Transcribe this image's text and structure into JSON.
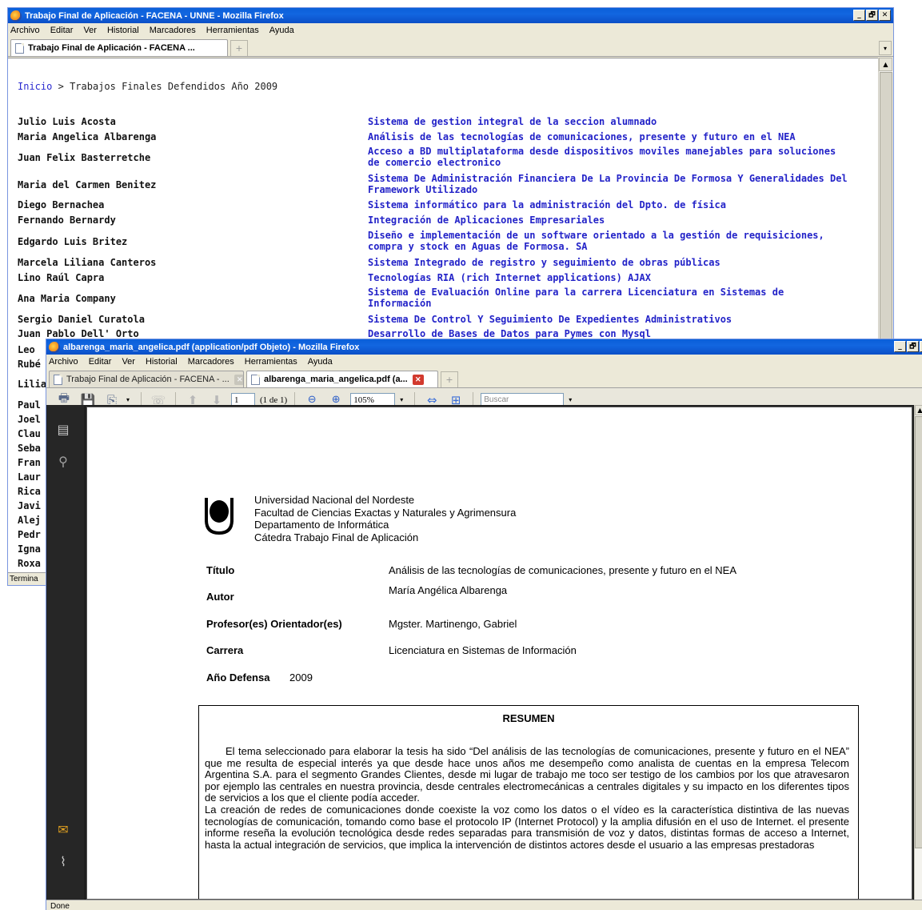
{
  "window1": {
    "title": "Trabajo Final de Aplicación - FACENA - UNNE - Mozilla Firefox",
    "window_controls": [
      "_",
      "🗗",
      "✕"
    ],
    "menu": [
      "Archivo",
      "Editar",
      "Ver",
      "Historial",
      "Marcadores",
      "Herramientas",
      "Ayuda"
    ],
    "tab_label": "Trabajo Final de Aplicación - FACENA ...",
    "breadcrumb": {
      "home": "Inicio",
      "separator": ">",
      "current": "Trabajos Finales Defendidos Año 2009"
    },
    "rows": [
      {
        "author": "Julio Luis Acosta",
        "title": "Sistema de gestion integral de la seccion alumnado"
      },
      {
        "author": "Maria Angelica Albarenga",
        "title": "Análisis de las tecnologías de comunicaciones, presente y futuro en el NEA"
      },
      {
        "author": "Juan Felix Basterretche",
        "title": "Acceso a BD multiplataforma desde dispositivos moviles manejables para soluciones de comercio electronico"
      },
      {
        "author": "Maria del Carmen Benitez",
        "title": "Sistema De Administración Financiera De La Provincia De Formosa Y Generalidades Del Framework Utilizado"
      },
      {
        "author": "Diego Bernachea",
        "title": "Sistema informático para la administración del Dpto. de física"
      },
      {
        "author": "Fernando Bernardy",
        "title": "Integración de Aplicaciones Empresariales"
      },
      {
        "author": "Edgardo Luis Britez",
        "title": "Diseño e implementación de un software orientado a la gestión de requisiciones, compra y stock en Aguas de Formosa. SA"
      },
      {
        "author": "Marcela Liliana Canteros",
        "title": "Sistema Integrado de registro y seguimiento de obras públicas"
      },
      {
        "author": "Lino Raúl Capra",
        "title": "Tecnologías RIA (rich Internet applications) AJAX"
      },
      {
        "author": "Ana Maria Company",
        "title": "Sistema de Evaluación Online para la carrera Licenciatura en Sistemas de Información"
      },
      {
        "author": "Sergio Daniel Curatola",
        "title": "Sistema De Control Y Seguimiento De Expedientes Administrativos"
      },
      {
        "author": "Juan Pablo Dell' Orto",
        "title": "Desarrollo de Bases de Datos para Pymes con Mysql"
      }
    ],
    "partial_authors": [
      "Leo",
      "Rubé",
      "Lilian",
      "Paul",
      "Joel",
      "Clau",
      "Seba",
      "Fran",
      "Laur",
      "Rica",
      "Javi",
      "Alej",
      "Pedr",
      "Igna",
      "Roxa"
    ],
    "status": "Termina"
  },
  "window2": {
    "title": "albarenga_maria_angelica.pdf (application/pdf Objeto) - Mozilla Firefox",
    "window_controls": [
      "_",
      "🗗",
      "✕"
    ],
    "menu": [
      "Archivo",
      "Editar",
      "Ver",
      "Historial",
      "Marcadores",
      "Herramientas",
      "Ayuda"
    ],
    "tabs": [
      {
        "label": "Trabajo Final de Aplicación - FACENA - ...",
        "active": false
      },
      {
        "label": "albarenga_maria_angelica.pdf (a...",
        "active": true
      }
    ],
    "toolbar": {
      "page_number": "1",
      "page_count": "(1 de 1)",
      "zoom": "105%",
      "search_placeholder": "Buscar"
    },
    "status": "Done",
    "document": {
      "institution": [
        "Universidad Nacional del Nordeste",
        "Facultad de Ciencias Exactas y Naturales y Agrimensura",
        "Departamento de Informática",
        "Cátedra Trabajo Final de Aplicación"
      ],
      "fields": {
        "titulo_label": "Título",
        "titulo_value": "Análisis de las tecnologías de comunicaciones, presente y futuro en el NEA",
        "autor_label": "Autor",
        "autor_value": "María Angélica Albarenga",
        "profesor_label": "Profesor(es) Orientador(es)",
        "profesor_value": "Mgster. Martinengo, Gabriel",
        "carrera_label": "Carrera",
        "carrera_value": "Licenciatura en Sistemas de Información",
        "anio_label": "Año Defensa",
        "anio_value": "2009"
      },
      "resumen_title": "RESUMEN",
      "resumen_p1": "El tema seleccionado para elaborar la tesis ha sido “Del análisis de las tecnologías de comunicaciones, presente y futuro en el NEA” que me resulta de especial interés ya que desde hace unos años me desempeño como analista de cuentas en la empresa Telecom Argentina S.A. para el segmento Grandes Clientes, desde mi lugar de trabajo me toco ser testigo de los cambios por los que atravesaron por ejemplo las centrales en nuestra provincia, desde centrales electromecánicas a centrales digitales y su impacto en los diferentes tipos de servicios a los que el cliente podía acceder.",
      "resumen_p2": "La creación de redes de comunicaciones donde coexiste la voz como los datos o el vídeo es la característica distintiva de las nuevas tecnologías de comunicación, tomando como base el protocolo IP (Internet Protocol) y la amplia difusión en el uso de Internet. el presente informe reseña la evolución tecnológica desde redes separadas para transmisión de voz y datos, distintas formas de acceso a Internet, hasta la actual integración de servicios, que implica la intervención de distintos actores desde el usuario a las empresas prestadoras"
    }
  }
}
